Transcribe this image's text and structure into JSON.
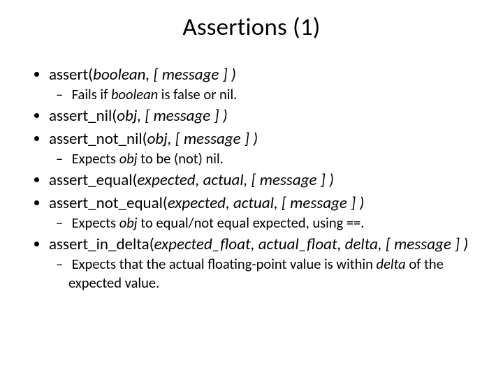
{
  "title": "Assertions (1)",
  "items": [
    {
      "prefix": "assert(",
      "args": "boolean, [ message ] )",
      "sub": {
        "pre": "Fails if ",
        "em": "boolean",
        "post": " is false or nil."
      }
    },
    {
      "prefix": "assert_nil(",
      "args": "obj, [ message ] )"
    },
    {
      "prefix": "assert_not_nil(",
      "args": "obj, [ message ] )",
      "sub": {
        "pre": "Expects ",
        "em": "obj",
        "post": " to be (not) nil."
      }
    },
    {
      "prefix": "assert_equal(",
      "args": "expected, actual, [ message ] )"
    },
    {
      "prefix": "assert_not_equal(",
      "args": "expected, actual, [ message ] )",
      "sub": {
        "pre": "Expects ",
        "em": "obj",
        "post": " to equal/not equal expected, using ==."
      }
    },
    {
      "prefix": "assert_in_delta(",
      "args": "expected_float, actual_float, delta, [ message ] )",
      "sub": {
        "pre": "Expects that the actual floating-point value is within ",
        "em": "delta",
        "post": " of the expected value."
      }
    }
  ]
}
